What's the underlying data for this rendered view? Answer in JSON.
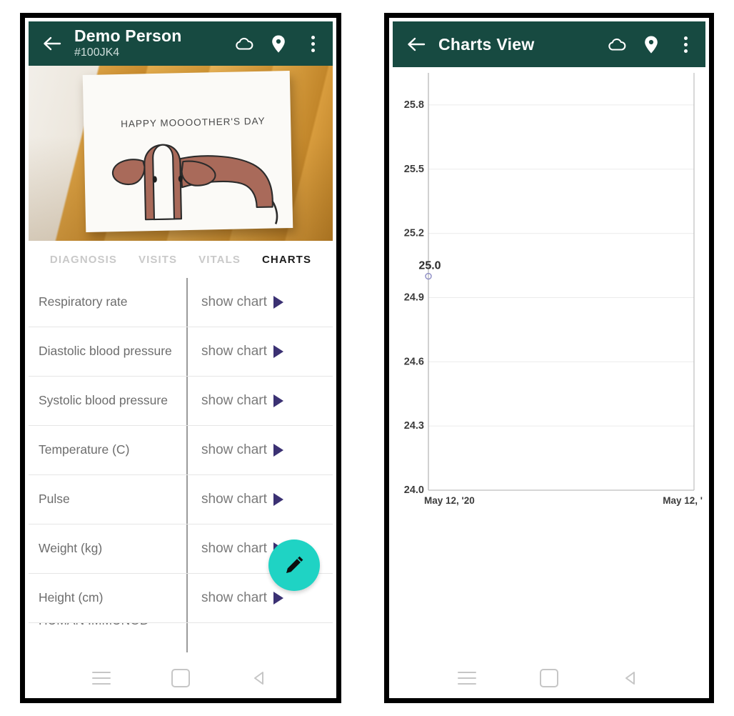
{
  "left_screen": {
    "appbar": {
      "back_icon": "back-arrow-icon",
      "title": "Demo Person",
      "subtitle": "#100JK4",
      "cloud_icon": "cloud-icon",
      "location_icon": "location-pin-icon",
      "overflow_icon": "more-vertical-icon",
      "bg_color": "#174a41"
    },
    "hero": {
      "card_text": "HAPPY MOOOOTHER'S DAY",
      "alt": "greeting card with cow drawing on wooden table"
    },
    "tabs": [
      {
        "label": "DIAGNOSIS",
        "active": false
      },
      {
        "label": "VISITS",
        "active": false
      },
      {
        "label": "VITALS",
        "active": false
      },
      {
        "label": "CHARTS",
        "active": true
      }
    ],
    "list": {
      "action_label": "show chart",
      "arrow_color": "#3b3173",
      "rows": [
        {
          "label": "Respiratory rate"
        },
        {
          "label": "Diastolic blood pressure"
        },
        {
          "label": "Systolic blood pressure"
        },
        {
          "label": "Temperature (C)"
        },
        {
          "label": "Pulse"
        },
        {
          "label": "Weight (kg)"
        },
        {
          "label": "Height (cm)"
        }
      ],
      "cut_row_label": "HUMAN IMMUNOD"
    },
    "fab": {
      "icon": "pencil-icon",
      "color": "#1fd3c4"
    },
    "navbar": {
      "recents_icon": "menu-lines-icon",
      "home_icon": "home-square-icon",
      "back_icon": "back-triangle-icon"
    }
  },
  "right_screen": {
    "appbar": {
      "back_icon": "back-arrow-icon",
      "title": "Charts View",
      "cloud_icon": "cloud-icon",
      "location_icon": "location-pin-icon",
      "overflow_icon": "more-vertical-icon",
      "bg_color": "#174a41"
    },
    "navbar": {
      "recents_icon": "menu-lines-icon",
      "home_icon": "home-square-icon",
      "back_icon": "back-triangle-icon"
    }
  },
  "chart_data": {
    "type": "line",
    "title": "",
    "xlabel": "",
    "ylabel": "",
    "grid": true,
    "legend": false,
    "ylim": [
      24.0,
      25.95
    ],
    "yticks": [
      "25.8",
      "25.5",
      "25.2",
      "24.9",
      "24.6",
      "24.3",
      "24.0"
    ],
    "ytick_values": [
      25.8,
      25.5,
      25.2,
      24.9,
      24.6,
      24.3,
      24.0
    ],
    "xticks": [
      "May 12, '20",
      "May 12, '"
    ],
    "x": [
      "May 12, '20"
    ],
    "series": [
      {
        "name": "",
        "values": [
          25.0
        ],
        "point_labels": [
          "25.0"
        ],
        "marker": "circle-open",
        "color": "#8b8bc4"
      }
    ],
    "axis_color": "#bdbdbd",
    "grid_color": "#ebebeb",
    "label_color": "#3c3c3c"
  }
}
